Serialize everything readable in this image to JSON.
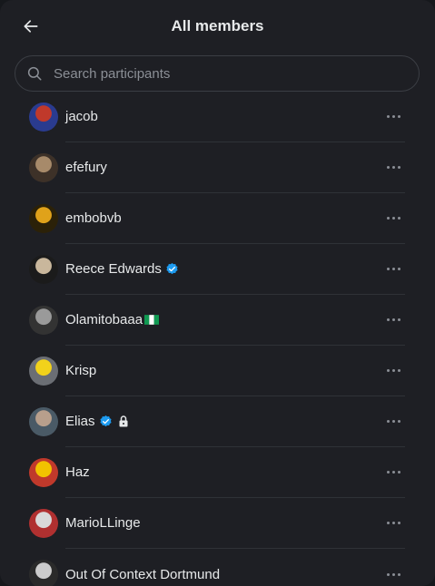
{
  "header": {
    "title": "All members"
  },
  "search": {
    "placeholder": "Search participants"
  },
  "members": [
    {
      "name": "jacob",
      "verified": false,
      "flag": false,
      "locked": false,
      "avatar_colors": [
        "#c0392b",
        "#2a3b8f"
      ]
    },
    {
      "name": "efefury",
      "verified": false,
      "flag": false,
      "locked": false,
      "avatar_colors": [
        "#a78a6a",
        "#3d3128"
      ]
    },
    {
      "name": "embobvb",
      "verified": false,
      "flag": false,
      "locked": false,
      "avatar_colors": [
        "#e0a21a",
        "#2b2108"
      ]
    },
    {
      "name": "Reece Edwards",
      "verified": true,
      "flag": false,
      "locked": false,
      "avatar_colors": [
        "#c9b79c",
        "#1b1b1b"
      ]
    },
    {
      "name": "Olamitobaaa",
      "verified": false,
      "flag": true,
      "locked": false,
      "avatar_colors": [
        "#9a9a9a",
        "#333333"
      ]
    },
    {
      "name": "Krisp",
      "verified": false,
      "flag": false,
      "locked": false,
      "avatar_colors": [
        "#f2d21b",
        "#6b6e74"
      ]
    },
    {
      "name": "Elias",
      "verified": true,
      "flag": false,
      "locked": true,
      "avatar_colors": [
        "#b89f8c",
        "#4a5a66"
      ]
    },
    {
      "name": "Haz",
      "verified": false,
      "flag": false,
      "locked": false,
      "avatar_colors": [
        "#f2c300",
        "#c0392b"
      ]
    },
    {
      "name": "MarioLLinge",
      "verified": false,
      "flag": false,
      "locked": false,
      "avatar_colors": [
        "#d9d9d9",
        "#b03030"
      ]
    },
    {
      "name": "Out Of Context Dortmund",
      "verified": false,
      "flag": false,
      "locked": false,
      "avatar_colors": [
        "#cccccc",
        "#2a2a2a"
      ]
    }
  ],
  "colors": {
    "verified": "#1d9bf0",
    "muted": "#8b8f96",
    "text": "#e7e9ea"
  }
}
